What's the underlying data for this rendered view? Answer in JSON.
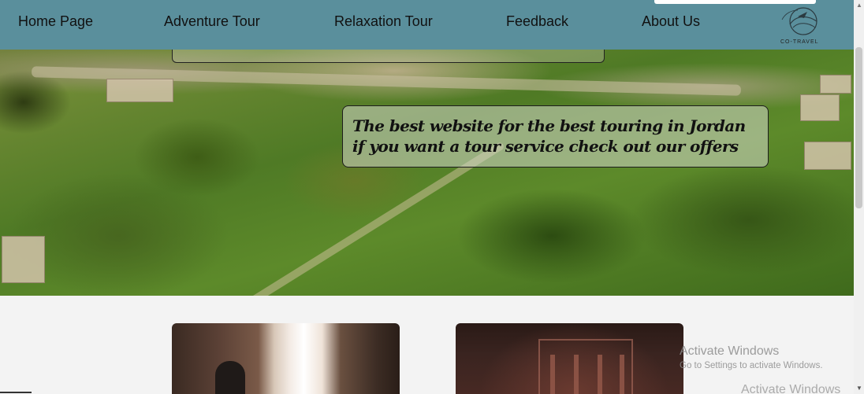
{
  "nav": {
    "items": [
      {
        "label": "Home Page"
      },
      {
        "label": "Adventure Tour"
      },
      {
        "label": "Relaxation Tour"
      },
      {
        "label": "Feedback"
      },
      {
        "label": "About Us"
      }
    ],
    "logo_text": "CO-TRAVEL"
  },
  "hero": {
    "caption": "The best website for the best touring in Jordan if you want a tour service check out our offers"
  },
  "cards": [
    {
      "name": "siq-canyon"
    },
    {
      "name": "petra-treasury"
    }
  ],
  "watermark": {
    "title": "Activate Windows",
    "subtitle": "Go to Settings to activate Windows.",
    "title_repeat": "Activate Windows"
  },
  "colors": {
    "navbar": "#5a8f9c",
    "page_bg": "#f3f3f3"
  }
}
